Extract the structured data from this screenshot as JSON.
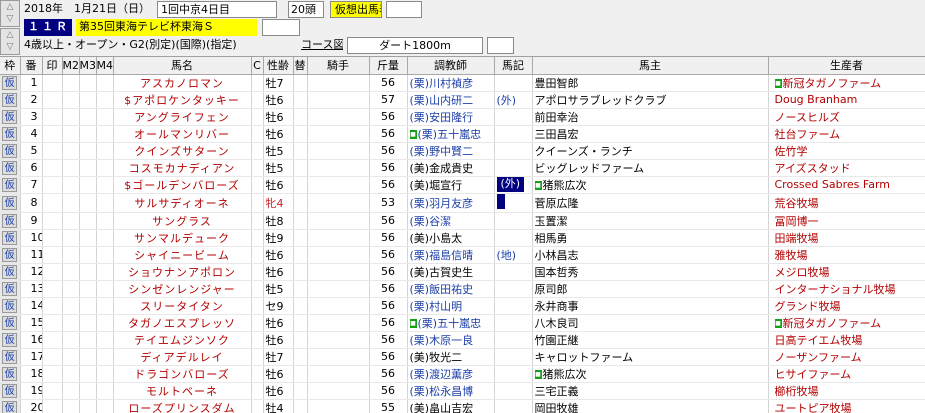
{
  "header": {
    "date": "2018年　1月21日（日）",
    "kaisai": "1回中京4日目",
    "heads": "20頭",
    "mode_label": "仮想出馬表",
    "race_no": "１１Ｒ",
    "race_name": "第35回東海テレビ杯東海Ｓ",
    "conditions": "4歳以上・オープン・G2(別定)(国際)(指定)",
    "course_label": "コース図",
    "course": "ダート1800m"
  },
  "columns": {
    "waku": "枠",
    "umaban": "番",
    "mark": "印",
    "m2": "M2",
    "m3": "M3",
    "m4": "M4",
    "horse": "馬名",
    "c": "C",
    "sexage": "性齢",
    "change": "替",
    "jockey": "騎手",
    "weight": "斤量",
    "trainer": "調教師",
    "note": "馬記",
    "owner": "馬主",
    "breeder": "生産者"
  },
  "kari_label": "仮",
  "rows": [
    {
      "n": "1",
      "horse": "アスカノロマン",
      "sex": "牡7",
      "w": "56",
      "tr": "(栗)川村禎彦",
      "loc": "ritto",
      "sq": false,
      "note": "",
      "nb": false,
      "ownsq": false,
      "owner": "豊田智郎",
      "bsq": true,
      "breeder": "新冠タガノファーム"
    },
    {
      "n": "2",
      "horse": "$アポロケンタッキー",
      "sex": "牡6",
      "w": "57",
      "tr": "(栗)山内研二",
      "loc": "ritto",
      "sq": false,
      "note": "(外)",
      "nb": false,
      "ownsq": false,
      "owner": "アポロサラブレッドクラブ",
      "bsq": false,
      "breeder": "Doug Branham"
    },
    {
      "n": "3",
      "horse": "アングライフェン",
      "sex": "牡6",
      "w": "56",
      "tr": "(栗)安田隆行",
      "loc": "ritto",
      "sq": false,
      "note": "",
      "nb": false,
      "ownsq": false,
      "owner": "前田幸治",
      "bsq": false,
      "breeder": "ノースヒルズ"
    },
    {
      "n": "4",
      "horse": "オールマンリバー",
      "sex": "牡6",
      "w": "56",
      "tr": "(栗)五十嵐忠",
      "loc": "ritto",
      "sq": true,
      "note": "",
      "nb": false,
      "ownsq": false,
      "owner": "三田昌宏",
      "bsq": false,
      "breeder": "社台ファーム"
    },
    {
      "n": "5",
      "horse": "クインズサターン",
      "sex": "牡5",
      "w": "56",
      "tr": "(栗)野中賢二",
      "loc": "ritto",
      "sq": false,
      "note": "",
      "nb": false,
      "ownsq": false,
      "owner": "クイーンズ・ランチ",
      "bsq": false,
      "breeder": "佐竹学"
    },
    {
      "n": "6",
      "horse": "コスモカナディアン",
      "sex": "牡5",
      "w": "56",
      "tr": "(美)金成貴史",
      "loc": "miho",
      "sq": false,
      "note": "",
      "nb": false,
      "ownsq": false,
      "owner": "ビッグレッドファーム",
      "bsq": false,
      "breeder": "アイズスタッド"
    },
    {
      "n": "7",
      "horse": "$ゴールデンバローズ",
      "sex": "牡6",
      "w": "56",
      "tr": "(美)堀宣行",
      "loc": "miho",
      "sq": false,
      "note": "(外)",
      "nb": true,
      "ownsq": true,
      "owner": "猪熊広次",
      "bsq": false,
      "breeder": "Crossed Sabres Farm"
    },
    {
      "n": "8",
      "horse": "サルサディオーネ",
      "sex": "牝4",
      "w": "53",
      "tr": "(栗)羽月友彦",
      "loc": "ritto",
      "sq": false,
      "note": "",
      "nb": true,
      "ownsq": false,
      "owner": "菅原広隆",
      "bsq": false,
      "breeder": "荒谷牧場"
    },
    {
      "n": "9",
      "horse": "サングラス",
      "sex": "牡8",
      "w": "56",
      "tr": "(栗)谷潔",
      "loc": "ritto",
      "sq": false,
      "note": "",
      "nb": false,
      "ownsq": false,
      "owner": "玉置潔",
      "bsq": false,
      "breeder": "冨岡博一"
    },
    {
      "n": "10",
      "horse": "サンマルデューク",
      "sex": "牡9",
      "w": "56",
      "tr": "(美)小島太",
      "loc": "miho",
      "sq": false,
      "note": "",
      "nb": false,
      "ownsq": false,
      "owner": "相馬勇",
      "bsq": false,
      "breeder": "田端牧場"
    },
    {
      "n": "11",
      "horse": "シャイニービーム",
      "sex": "牡6",
      "w": "56",
      "tr": "(栗)福島信晴",
      "loc": "ritto",
      "sq": false,
      "note": "(地)",
      "nb": false,
      "ownsq": false,
      "owner": "小林昌志",
      "bsq": false,
      "breeder": "雅牧場"
    },
    {
      "n": "12",
      "horse": "ショウナンアポロン",
      "sex": "牡6",
      "w": "56",
      "tr": "(美)古賀史生",
      "loc": "miho",
      "sq": false,
      "note": "",
      "nb": false,
      "ownsq": false,
      "owner": "国本哲秀",
      "bsq": false,
      "breeder": "メジロ牧場"
    },
    {
      "n": "13",
      "horse": "シンゼンレンジャー",
      "sex": "牡5",
      "w": "56",
      "tr": "(栗)飯田祐史",
      "loc": "ritto",
      "sq": false,
      "note": "",
      "nb": false,
      "ownsq": false,
      "owner": "原司郎",
      "bsq": false,
      "breeder": "インターナショナル牧場"
    },
    {
      "n": "14",
      "horse": "スリータイタン",
      "sex": "セ9",
      "w": "56",
      "tr": "(栗)村山明",
      "loc": "ritto",
      "sq": false,
      "note": "",
      "nb": false,
      "ownsq": false,
      "owner": "永井商事",
      "bsq": false,
      "breeder": "グランド牧場"
    },
    {
      "n": "15",
      "horse": "タガノエスプレッソ",
      "sex": "牡6",
      "w": "56",
      "tr": "(栗)五十嵐忠",
      "loc": "ritto",
      "sq": true,
      "note": "",
      "nb": false,
      "ownsq": false,
      "owner": "八木良司",
      "bsq": true,
      "breeder": "新冠タガノファーム"
    },
    {
      "n": "16",
      "horse": "テイエムジンソク",
      "sex": "牡6",
      "w": "56",
      "tr": "(栗)木原一良",
      "loc": "ritto",
      "sq": false,
      "note": "",
      "nb": false,
      "ownsq": false,
      "owner": "竹園正継",
      "bsq": false,
      "breeder": "日高テイエム牧場"
    },
    {
      "n": "17",
      "horse": "ディアデルレイ",
      "sex": "牡7",
      "w": "56",
      "tr": "(美)牧光二",
      "loc": "miho",
      "sq": false,
      "note": "",
      "nb": false,
      "ownsq": false,
      "owner": "キャロットファーム",
      "bsq": false,
      "breeder": "ノーザンファーム"
    },
    {
      "n": "18",
      "horse": "ドラゴンバローズ",
      "sex": "牡6",
      "w": "56",
      "tr": "(栗)渡辺薫彦",
      "loc": "ritto",
      "sq": false,
      "note": "",
      "nb": false,
      "ownsq": true,
      "owner": "猪熊広次",
      "bsq": false,
      "breeder": "ヒサイファーム"
    },
    {
      "n": "19",
      "horse": "モルトベーネ",
      "sex": "牡6",
      "w": "56",
      "tr": "(栗)松永昌博",
      "loc": "ritto",
      "sq": false,
      "note": "",
      "nb": false,
      "ownsq": false,
      "owner": "三宅正義",
      "bsq": false,
      "breeder": "櫛桁牧場"
    },
    {
      "n": "20",
      "horse": "ローズプリンスダム",
      "sex": "牡4",
      "w": "55",
      "tr": "(美)畠山吉宏",
      "loc": "miho",
      "sq": false,
      "note": "",
      "nb": false,
      "ownsq": false,
      "owner": "岡田牧雄",
      "bsq": false,
      "breeder": "ユートピア牧場"
    }
  ]
}
